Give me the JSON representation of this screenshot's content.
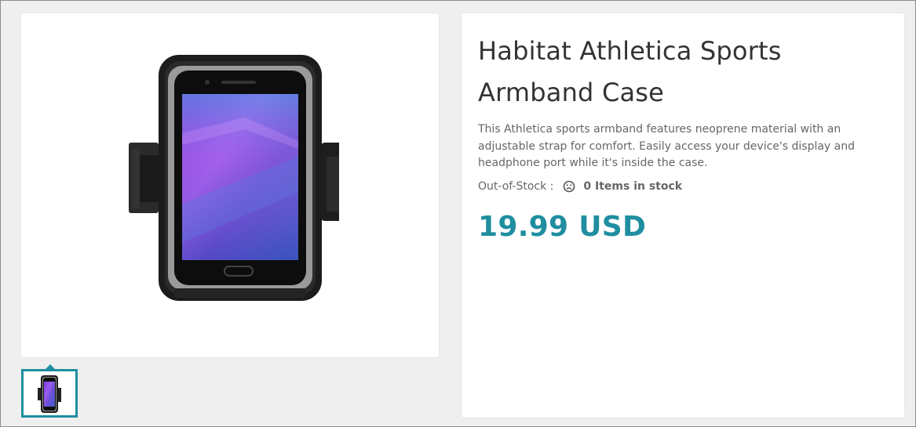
{
  "product": {
    "title": "Habitat Athletica Sports Armband Case",
    "description": "This Athletica sports armband features neoprene material with an adjustable strap for comfort. Easily access your device's display and headphone port while it's inside the case.",
    "stock_label": "Out-of-Stock :",
    "stock_icon": "sad-face-icon",
    "stock_value": "0 Items in stock",
    "price": "19.99 USD"
  },
  "gallery": {
    "main_image": "armband-phone-case",
    "thumbnails": [
      "armband-phone-case"
    ],
    "selected_index": 0
  },
  "colors": {
    "accent": "#1f8ea0",
    "page_background": "#efefef",
    "card_background": "#ffffff",
    "text_muted": "#666666",
    "title_text": "#333333"
  }
}
